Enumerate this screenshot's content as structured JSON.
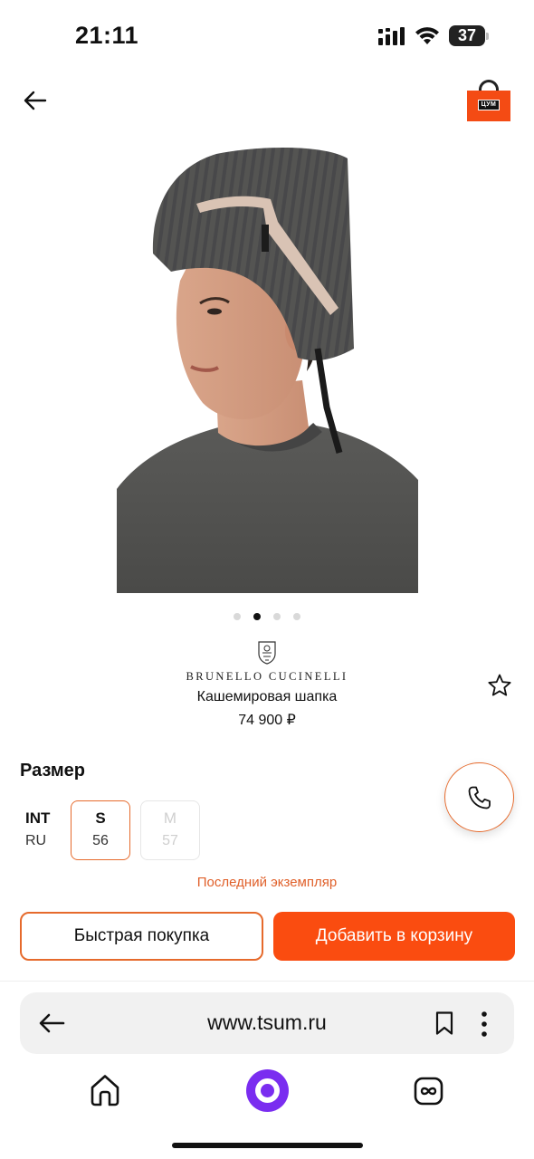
{
  "status_bar": {
    "time": "21:11",
    "battery": "37"
  },
  "header": {
    "bag_logo_text": "ЦУМ"
  },
  "gallery": {
    "pages": 4,
    "active_index": 1
  },
  "product": {
    "brand": "BRUNELLO CUCINELLI",
    "name": "Кашемировая шапка",
    "price": "74 900 ₽"
  },
  "size": {
    "title": "Размер",
    "systems": {
      "int": "INT",
      "ru": "RU"
    },
    "options": [
      {
        "int": "S",
        "ru": "56",
        "selected": true,
        "available": true
      },
      {
        "int": "M",
        "ru": "57",
        "selected": false,
        "available": false
      }
    ],
    "stock_note": "Последний экземпляр"
  },
  "actions": {
    "quick_buy": "Быстрая покупка",
    "add_to_cart": "Добавить в корзину"
  },
  "browser": {
    "url": "www.tsum.ru"
  },
  "colors": {
    "accent": "#fa4c10",
    "accent_border": "#e66a2c",
    "alice": "#7a2df0"
  }
}
